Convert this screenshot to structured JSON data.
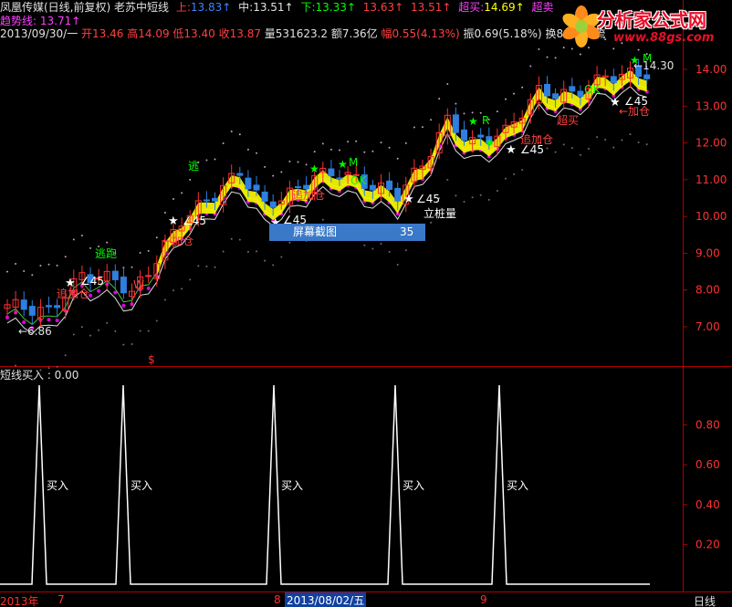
{
  "header": {
    "stock_name": "凤凰传媒(日线,前复权)",
    "indicator_name": "老苏中短线",
    "upper_label": "上:",
    "upper_value": "13.83↑",
    "mid_label": "中:",
    "mid_value": "13.51↑",
    "lower_label": "下:",
    "lower_value": "13.33↑",
    "extra_value": "13.63↑",
    "extra_value2": "13.51↑",
    "chaomai_label": "超买:",
    "chaomai_value": "14.69↑",
    "chaomai2_label": "超卖",
    "trend_label": "趋势线:",
    "trend_value": "13.71↑"
  },
  "quote": {
    "date": "2013/09/30/一",
    "open": "开13.46",
    "high": "高14.09",
    "low": "低13.40",
    "close": "收13.87",
    "volume": "量531623.2",
    "amount": "额7.36亿",
    "change": "幅0.55(4.13%)",
    "amplitude": "振0.69(5.18%)",
    "turnover": "换8.07%",
    "extra": "流"
  },
  "logo": {
    "brand": "分析家公式网",
    "url": "www.88gs.com"
  },
  "popup": {
    "label": "屏幕截图",
    "value": "35"
  },
  "price_axis": [
    "14.00",
    "13.00",
    "12.00",
    "11.00",
    "10.00",
    "9.00",
    "8.00",
    "7.00"
  ],
  "sub_axis": [
    "0.80",
    "0.60",
    "0.40",
    "0.20"
  ],
  "subpanel": {
    "title": "短线买入 : 0.00",
    "buy_label": "买入"
  },
  "date_axis": {
    "year": "2013年",
    "m7": "7",
    "m8": "8",
    "cursor_date": "2013/08/02/五",
    "m9": "9",
    "period": "日线"
  },
  "annotations": {
    "low_mark": "←6.86",
    "high_mark": "←14.30",
    "escape": "逃跑",
    "escape2": "逃",
    "add_pos": "←加仓",
    "add_pos2": "追加仓",
    "angle45": "∠45",
    "lizhuang": "立桩量",
    "ok": "OK",
    "m": "M",
    "r": "R",
    "chaomai": "超买",
    "dollar": "$",
    "w": "W"
  },
  "chart_data": {
    "type": "candlestick",
    "ylim": [
      6.5,
      14.6
    ],
    "buy_signal_ylim": [
      0,
      1
    ],
    "buy_signal_dates_index": [
      3,
      11,
      24,
      35,
      45
    ]
  },
  "colors": {
    "up": "#ff3030",
    "down": "#2f7fe0",
    "yellow": "#ffff00",
    "magenta_dots": "#e000e0",
    "axis": "#b00000",
    "green": "#00ff00"
  }
}
